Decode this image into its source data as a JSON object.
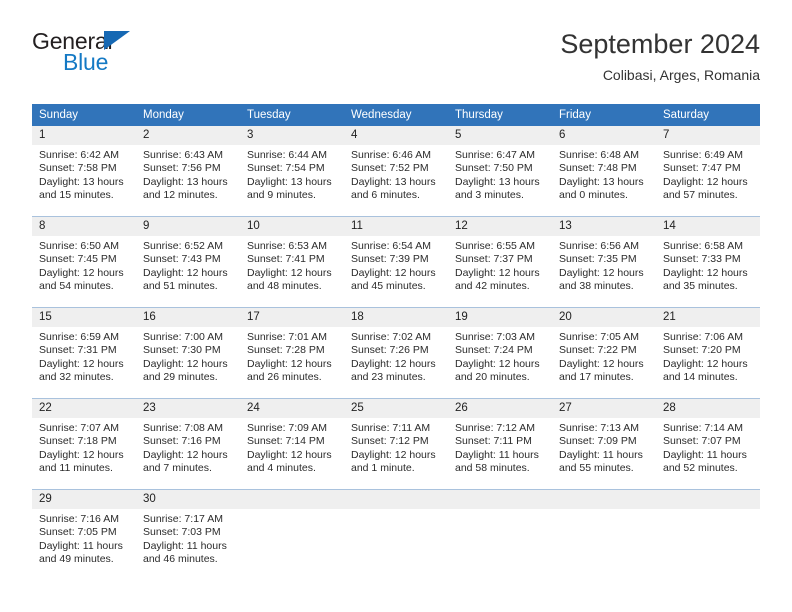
{
  "brand": {
    "name_part1": "General",
    "name_part2": "Blue",
    "triangle_color": "#1668b3",
    "blue_color": "#1479c4"
  },
  "header": {
    "title": "September 2024",
    "subtitle": "Colibasi, Arges, Romania"
  },
  "theme": {
    "header_row_bg": "#3174ba",
    "header_row_text": "#ffffff",
    "daynum_bg": "#efefef",
    "row_divider": "#a9c2dd"
  },
  "weekday_headers": [
    "Sunday",
    "Monday",
    "Tuesday",
    "Wednesday",
    "Thursday",
    "Friday",
    "Saturday"
  ],
  "weeks": [
    [
      {
        "day": "1",
        "sunrise": "Sunrise: 6:42 AM",
        "sunset": "Sunset: 7:58 PM",
        "daylight": "Daylight: 13 hours and 15 minutes."
      },
      {
        "day": "2",
        "sunrise": "Sunrise: 6:43 AM",
        "sunset": "Sunset: 7:56 PM",
        "daylight": "Daylight: 13 hours and 12 minutes."
      },
      {
        "day": "3",
        "sunrise": "Sunrise: 6:44 AM",
        "sunset": "Sunset: 7:54 PM",
        "daylight": "Daylight: 13 hours and 9 minutes."
      },
      {
        "day": "4",
        "sunrise": "Sunrise: 6:46 AM",
        "sunset": "Sunset: 7:52 PM",
        "daylight": "Daylight: 13 hours and 6 minutes."
      },
      {
        "day": "5",
        "sunrise": "Sunrise: 6:47 AM",
        "sunset": "Sunset: 7:50 PM",
        "daylight": "Daylight: 13 hours and 3 minutes."
      },
      {
        "day": "6",
        "sunrise": "Sunrise: 6:48 AM",
        "sunset": "Sunset: 7:48 PM",
        "daylight": "Daylight: 13 hours and 0 minutes."
      },
      {
        "day": "7",
        "sunrise": "Sunrise: 6:49 AM",
        "sunset": "Sunset: 7:47 PM",
        "daylight": "Daylight: 12 hours and 57 minutes."
      }
    ],
    [
      {
        "day": "8",
        "sunrise": "Sunrise: 6:50 AM",
        "sunset": "Sunset: 7:45 PM",
        "daylight": "Daylight: 12 hours and 54 minutes."
      },
      {
        "day": "9",
        "sunrise": "Sunrise: 6:52 AM",
        "sunset": "Sunset: 7:43 PM",
        "daylight": "Daylight: 12 hours and 51 minutes."
      },
      {
        "day": "10",
        "sunrise": "Sunrise: 6:53 AM",
        "sunset": "Sunset: 7:41 PM",
        "daylight": "Daylight: 12 hours and 48 minutes."
      },
      {
        "day": "11",
        "sunrise": "Sunrise: 6:54 AM",
        "sunset": "Sunset: 7:39 PM",
        "daylight": "Daylight: 12 hours and 45 minutes."
      },
      {
        "day": "12",
        "sunrise": "Sunrise: 6:55 AM",
        "sunset": "Sunset: 7:37 PM",
        "daylight": "Daylight: 12 hours and 42 minutes."
      },
      {
        "day": "13",
        "sunrise": "Sunrise: 6:56 AM",
        "sunset": "Sunset: 7:35 PM",
        "daylight": "Daylight: 12 hours and 38 minutes."
      },
      {
        "day": "14",
        "sunrise": "Sunrise: 6:58 AM",
        "sunset": "Sunset: 7:33 PM",
        "daylight": "Daylight: 12 hours and 35 minutes."
      }
    ],
    [
      {
        "day": "15",
        "sunrise": "Sunrise: 6:59 AM",
        "sunset": "Sunset: 7:31 PM",
        "daylight": "Daylight: 12 hours and 32 minutes."
      },
      {
        "day": "16",
        "sunrise": "Sunrise: 7:00 AM",
        "sunset": "Sunset: 7:30 PM",
        "daylight": "Daylight: 12 hours and 29 minutes."
      },
      {
        "day": "17",
        "sunrise": "Sunrise: 7:01 AM",
        "sunset": "Sunset: 7:28 PM",
        "daylight": "Daylight: 12 hours and 26 minutes."
      },
      {
        "day": "18",
        "sunrise": "Sunrise: 7:02 AM",
        "sunset": "Sunset: 7:26 PM",
        "daylight": "Daylight: 12 hours and 23 minutes."
      },
      {
        "day": "19",
        "sunrise": "Sunrise: 7:03 AM",
        "sunset": "Sunset: 7:24 PM",
        "daylight": "Daylight: 12 hours and 20 minutes."
      },
      {
        "day": "20",
        "sunrise": "Sunrise: 7:05 AM",
        "sunset": "Sunset: 7:22 PM",
        "daylight": "Daylight: 12 hours and 17 minutes."
      },
      {
        "day": "21",
        "sunrise": "Sunrise: 7:06 AM",
        "sunset": "Sunset: 7:20 PM",
        "daylight": "Daylight: 12 hours and 14 minutes."
      }
    ],
    [
      {
        "day": "22",
        "sunrise": "Sunrise: 7:07 AM",
        "sunset": "Sunset: 7:18 PM",
        "daylight": "Daylight: 12 hours and 11 minutes."
      },
      {
        "day": "23",
        "sunrise": "Sunrise: 7:08 AM",
        "sunset": "Sunset: 7:16 PM",
        "daylight": "Daylight: 12 hours and 7 minutes."
      },
      {
        "day": "24",
        "sunrise": "Sunrise: 7:09 AM",
        "sunset": "Sunset: 7:14 PM",
        "daylight": "Daylight: 12 hours and 4 minutes."
      },
      {
        "day": "25",
        "sunrise": "Sunrise: 7:11 AM",
        "sunset": "Sunset: 7:12 PM",
        "daylight": "Daylight: 12 hours and 1 minute."
      },
      {
        "day": "26",
        "sunrise": "Sunrise: 7:12 AM",
        "sunset": "Sunset: 7:11 PM",
        "daylight": "Daylight: 11 hours and 58 minutes."
      },
      {
        "day": "27",
        "sunrise": "Sunrise: 7:13 AM",
        "sunset": "Sunset: 7:09 PM",
        "daylight": "Daylight: 11 hours and 55 minutes."
      },
      {
        "day": "28",
        "sunrise": "Sunrise: 7:14 AM",
        "sunset": "Sunset: 7:07 PM",
        "daylight": "Daylight: 11 hours and 52 minutes."
      }
    ],
    [
      {
        "day": "29",
        "sunrise": "Sunrise: 7:16 AM",
        "sunset": "Sunset: 7:05 PM",
        "daylight": "Daylight: 11 hours and 49 minutes."
      },
      {
        "day": "30",
        "sunrise": "Sunrise: 7:17 AM",
        "sunset": "Sunset: 7:03 PM",
        "daylight": "Daylight: 11 hours and 46 minutes."
      },
      {
        "day": "",
        "sunrise": "",
        "sunset": "",
        "daylight": ""
      },
      {
        "day": "",
        "sunrise": "",
        "sunset": "",
        "daylight": ""
      },
      {
        "day": "",
        "sunrise": "",
        "sunset": "",
        "daylight": ""
      },
      {
        "day": "",
        "sunrise": "",
        "sunset": "",
        "daylight": ""
      },
      {
        "day": "",
        "sunrise": "",
        "sunset": "",
        "daylight": ""
      }
    ]
  ]
}
